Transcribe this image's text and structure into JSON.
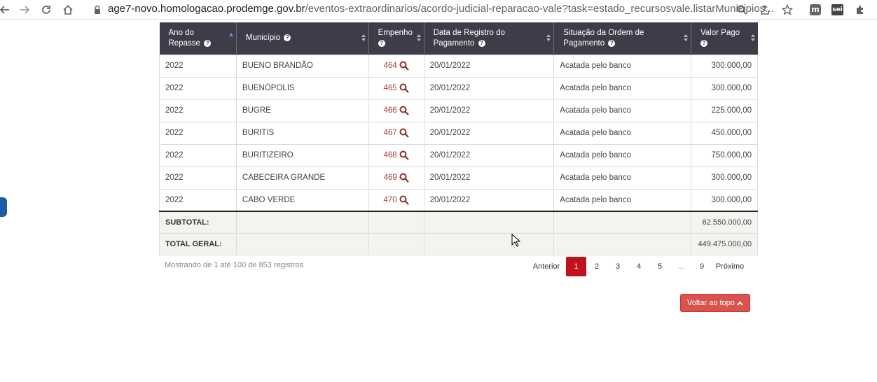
{
  "browser": {
    "url_domain": "age7-novo.homologacao.prodemge.gov.br",
    "url_path": "/eventos-extraordinarios/acordo-judicial-reparacao-vale?task=estado_recursosvale.listarMunicipios...",
    "ext_m": "m",
    "ext_sei": "sei"
  },
  "table": {
    "headers": {
      "ano": "Ano do Repasse",
      "municipio": "Município",
      "empenho": "Empenho",
      "data": "Data de Registro do Pagamento",
      "situacao": "Situação da Ordem de Pagamento",
      "valor": "Valor Pago"
    },
    "rows": [
      {
        "ano": "2022",
        "municipio": "BUENO BRANDÃO",
        "empenho": "464",
        "data": "20/01/2022",
        "situacao": "Acatada pelo banco",
        "valor": "300.000,00"
      },
      {
        "ano": "2022",
        "municipio": "BUENÓPOLIS",
        "empenho": "465",
        "data": "20/01/2022",
        "situacao": "Acatada pelo banco",
        "valor": "300.000,00"
      },
      {
        "ano": "2022",
        "municipio": "BUGRE",
        "empenho": "466",
        "data": "20/01/2022",
        "situacao": "Acatada pelo banco",
        "valor": "225.000,00"
      },
      {
        "ano": "2022",
        "municipio": "BURITIS",
        "empenho": "467",
        "data": "20/01/2022",
        "situacao": "Acatada pelo banco",
        "valor": "450.000,00"
      },
      {
        "ano": "2022",
        "municipio": "BURITIZEIRO",
        "empenho": "468",
        "data": "20/01/2022",
        "situacao": "Acatada pelo banco",
        "valor": "750.000,00"
      },
      {
        "ano": "2022",
        "municipio": "CABECEIRA GRANDE",
        "empenho": "469",
        "data": "20/01/2022",
        "situacao": "Acatada pelo banco",
        "valor": "300.000,00"
      },
      {
        "ano": "2022",
        "municipio": "CABO VERDE",
        "empenho": "470",
        "data": "20/01/2022",
        "situacao": "Acatada pelo banco",
        "valor": "300.000,00"
      }
    ],
    "subtotal_label": "SUBTOTAL:",
    "subtotal_value": "62.550.000,00",
    "total_label": "TOTAL GERAL:",
    "total_value": "449.475.000,00"
  },
  "pagination": {
    "info": "Mostrando de 1 até 100 de 853 registros",
    "prev": "Anterior",
    "pages": [
      "1",
      "2",
      "3",
      "4",
      "5"
    ],
    "dots": "...",
    "last": "9",
    "next": "Próximo",
    "active_page": "1"
  },
  "back_to_top": "Voltar ao topo",
  "colors": {
    "header_bg": "#3d3d4a",
    "active_page": "#c0121b",
    "button": "#d9534f",
    "empenho_link": "#a94442"
  }
}
